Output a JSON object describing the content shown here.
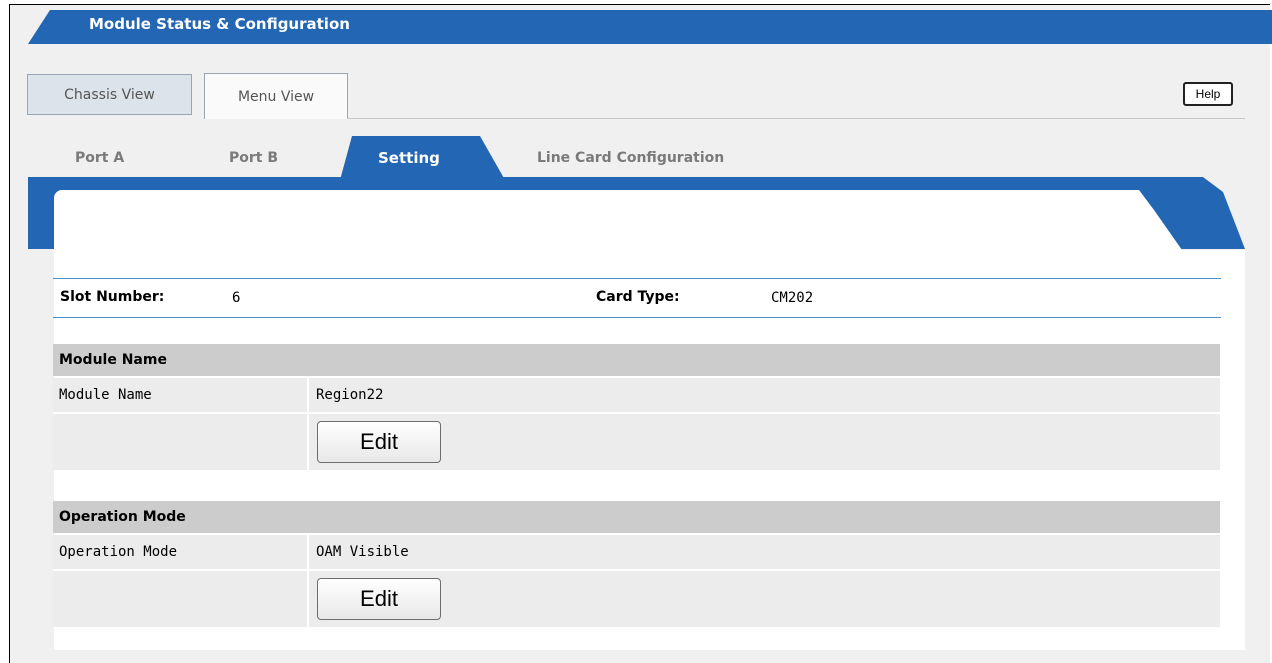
{
  "header": {
    "title": "Module Status & Configuration"
  },
  "view_tabs": [
    {
      "label": "Chassis View"
    },
    {
      "label": "Menu View"
    }
  ],
  "help_label": "Help",
  "sub_tabs": [
    {
      "label": "Port A"
    },
    {
      "label": "Port B"
    },
    {
      "label": "Setting",
      "active": true
    },
    {
      "label": "Line Card Configuration"
    }
  ],
  "info": {
    "slot_label": "Slot Number:",
    "slot_value": "6",
    "card_type_label": "Card Type:",
    "card_type_value": "CM202"
  },
  "sections": [
    {
      "title": "Module Name",
      "field_label": "Module Name",
      "field_value": "Region22",
      "button_label": "Edit"
    },
    {
      "title": "Operation Mode",
      "field_label": "Operation Mode",
      "field_value": "OAM Visible",
      "button_label": "Edit"
    }
  ],
  "colors": {
    "accent": "#2366b4",
    "section_header": "#cccccc",
    "row_bg": "#ececec",
    "divider": "#4a90c8"
  }
}
